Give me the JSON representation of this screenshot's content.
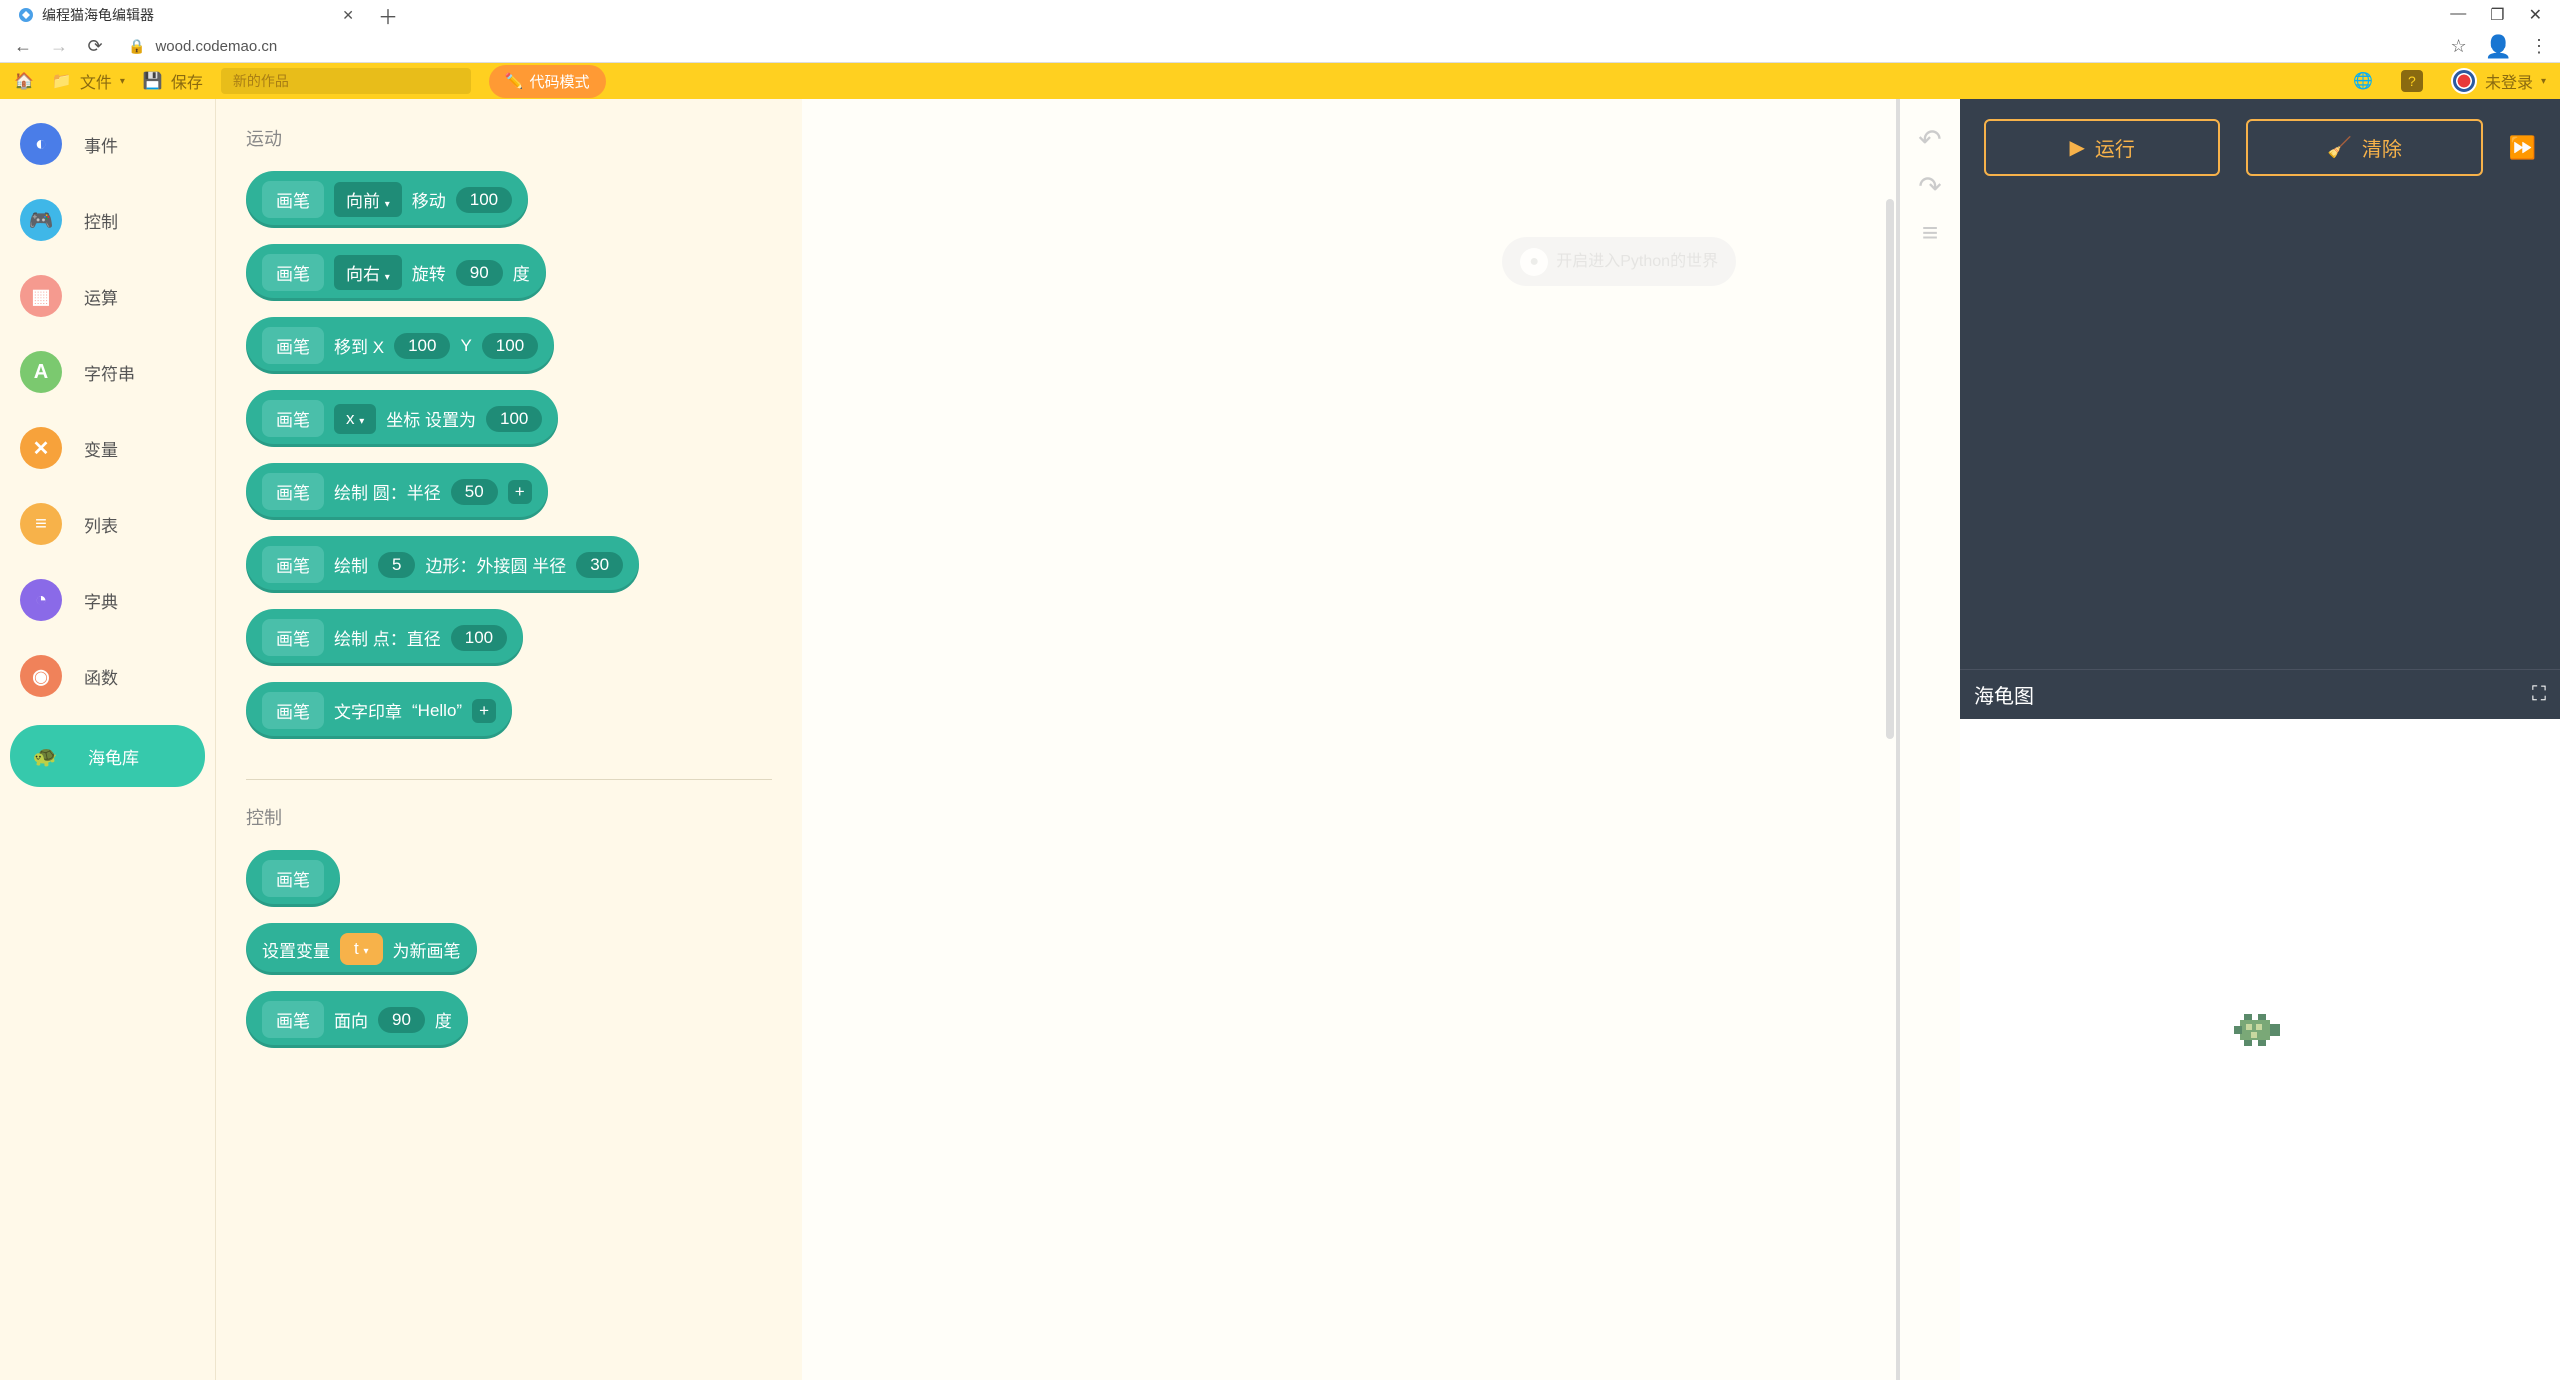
{
  "browser": {
    "tab_title": "编程猫海龟编辑器",
    "url": "wood.codemao.cn",
    "win_controls": {
      "min": "—",
      "max": "❐",
      "close": "✕"
    }
  },
  "toolbar": {
    "file_label": "文件",
    "save_label": "保存",
    "title_placeholder": "新的作品",
    "code_mode_label": "代码模式",
    "login_label": "未登录"
  },
  "categories": [
    {
      "id": "events",
      "label": "事件",
      "color": "#4a7de8",
      "glyph": "◐"
    },
    {
      "id": "control",
      "label": "控制",
      "color": "#3fb7e8",
      "glyph": "🎮"
    },
    {
      "id": "math",
      "label": "运算",
      "color": "#f59a8f",
      "glyph": "▦"
    },
    {
      "id": "string",
      "label": "字符串",
      "color": "#7bc96f",
      "glyph": "A"
    },
    {
      "id": "var",
      "label": "变量",
      "color": "#f7a23b",
      "glyph": "✕"
    },
    {
      "id": "list",
      "label": "列表",
      "color": "#f7b24a",
      "glyph": "≡"
    },
    {
      "id": "dict",
      "label": "字典",
      "color": "#8a6ae8",
      "glyph": "◔"
    },
    {
      "id": "func",
      "label": "函数",
      "color": "#f0825a",
      "glyph": "◉"
    },
    {
      "id": "turtle",
      "label": "海龟库",
      "color": "#36c9ac",
      "glyph": "",
      "active": true
    }
  ],
  "palette": {
    "section_motion": "运动",
    "section_control": "控制",
    "py_hint": "开启进入Python的世界",
    "block_pen": "画笔",
    "b1": {
      "dir": "向前",
      "act": "移动",
      "val": "100"
    },
    "b2": {
      "dir": "向右",
      "act": "旋转",
      "val": "90",
      "suf": "度"
    },
    "b3": {
      "p1": "移到 X",
      "v1": "100",
      "p2": "Y",
      "v2": "100"
    },
    "b4": {
      "axis": "x",
      "txt": "坐标 设置为",
      "val": "100"
    },
    "b5": {
      "txt": "绘制 圆：半径",
      "val": "50"
    },
    "b6": {
      "t1": "绘制",
      "sides": "5",
      "t2": "边形：外接圆 半径",
      "val": "30"
    },
    "b7": {
      "txt": "绘制 点：直径",
      "val": "100"
    },
    "b8": {
      "txt": "文字印章",
      "val": "“Hello”"
    },
    "b9": {
      "txt": "设置变量",
      "var": "t",
      "suf": "为新画笔"
    },
    "b10": {
      "txt": "面向",
      "val": "90",
      "suf": "度"
    }
  },
  "right": {
    "run_label": "运行",
    "clear_label": "清除",
    "turtle_title": "海龟图"
  }
}
